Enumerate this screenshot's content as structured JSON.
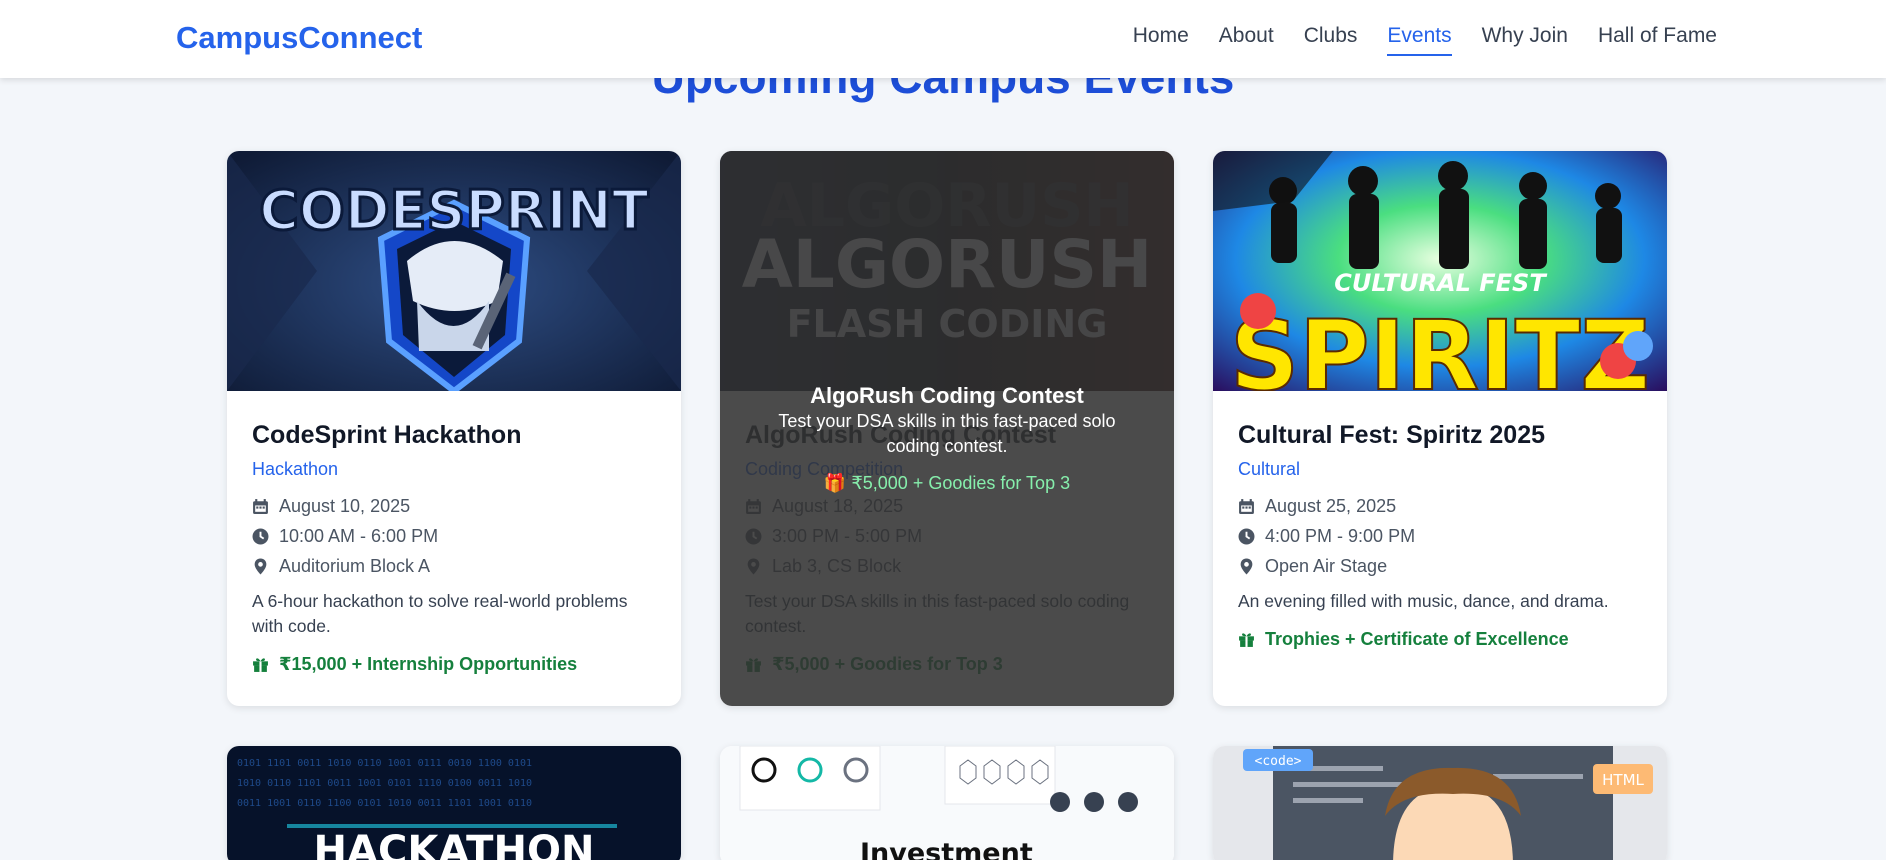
{
  "nav": {
    "brand": "CampusConnect",
    "links": [
      "Home",
      "About",
      "Clubs",
      "Events",
      "Why Join",
      "Hall of Fame"
    ],
    "active": "Events"
  },
  "section": {
    "title": "Upcoming Campus Events"
  },
  "events": [
    {
      "title": "CodeSprint Hackathon",
      "category": "Hackathon",
      "date": "August 10, 2025",
      "time": "10:00 AM - 6:00 PM",
      "location": "Auditorium Block A",
      "description": "A 6-hour hackathon to solve real-world problems with code.",
      "prize": "₹15,000 + Internship Opportunities",
      "banner_text": "CODESPRINT"
    },
    {
      "title": "AlgoRush Coding Contest",
      "category": "Coding Competition",
      "date": "August 18, 2025",
      "time": "3:00 PM - 5:00 PM",
      "location": "Lab 3, CS Block",
      "description": "Test your DSA skills in this fast-paced solo coding contest.",
      "prize": "₹5,000 + Goodies for Top 3",
      "banner_text_1": "ALGORUSH",
      "banner_text_2": "FLASH CODING",
      "overlay": {
        "title": "AlgoRush Coding Contest",
        "description": "Test your DSA skills in this fast-paced solo coding contest.",
        "prize": "🎁 ₹5,000 + Goodies for Top 3"
      }
    },
    {
      "title": "Cultural Fest: Spiritz 2025",
      "category": "Cultural",
      "date": "August 25, 2025",
      "time": "4:00 PM - 9:00 PM",
      "location": "Open Air Stage",
      "description": "An evening filled with music, dance, and drama.",
      "prize": "Trophies + Certificate of Excellence",
      "banner_text_1": "CULTURAL FEST",
      "banner_text_2": "SPIRITZ"
    }
  ],
  "lower_cards": [
    {
      "banner_text": "HACKATHON"
    },
    {
      "banner_text": "Investment"
    },
    {
      "banner_tag": "<code>",
      "banner_tag_2": "HTML"
    }
  ],
  "colors": {
    "brand": "#2563eb",
    "prize": "#15803d",
    "overlay_prize": "#86efac"
  }
}
